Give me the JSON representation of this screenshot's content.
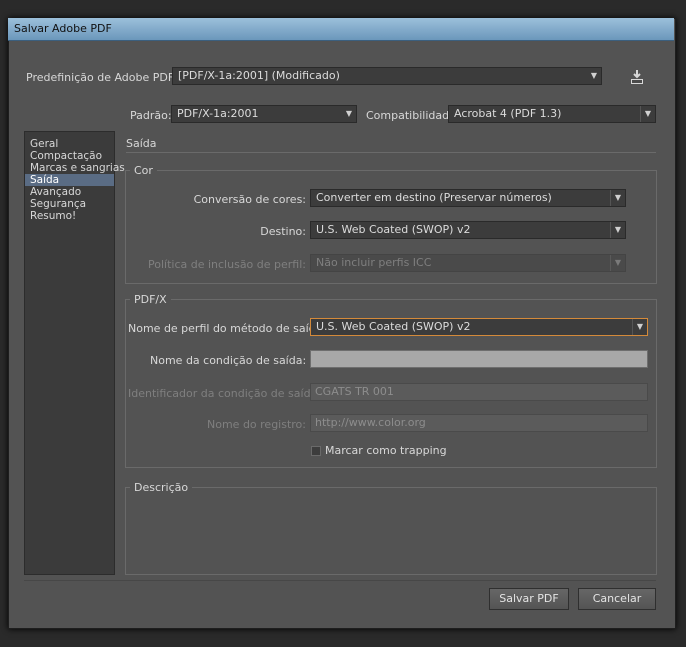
{
  "window": {
    "title": "Salvar Adobe PDF"
  },
  "preset": {
    "label": "Predefinição de Adobe PDF:",
    "value": "[PDF/X-1a:2001] (Modificado)",
    "save_icon": "save-preset-icon"
  },
  "standard": {
    "label": "Padrão:",
    "value": "PDF/X-1a:2001"
  },
  "compat": {
    "label": "Compatibilidade:",
    "value": "Acrobat 4 (PDF 1.3)"
  },
  "sidebar": {
    "items": [
      {
        "label": "Geral"
      },
      {
        "label": "Compactação"
      },
      {
        "label": "Marcas e sangrias"
      },
      {
        "label": "Saída"
      },
      {
        "label": "Avançado"
      },
      {
        "label": "Segurança"
      },
      {
        "label": "Resumo!"
      }
    ],
    "selected_index": 3
  },
  "section_title": "Saída",
  "color_group": {
    "title": "Cor",
    "conversion": {
      "label": "Conversão de cores:",
      "value": "Converter em destino (Preservar números)"
    },
    "destination": {
      "label": "Destino:",
      "value": "U.S. Web Coated (SWOP) v2"
    },
    "profile_policy": {
      "label": "Política de inclusão de perfil:",
      "value": "Não incluir perfis ICC"
    }
  },
  "pdfx_group": {
    "title": "PDF/X",
    "output_profile": {
      "label": "Nome de perfil do método de saída:",
      "value": "U.S. Web Coated (SWOP) v2"
    },
    "output_condition_name": {
      "label": "Nome da condição de saída:",
      "value": ""
    },
    "output_condition_id": {
      "label": "Identificador da condição de saída:",
      "value": "CGATS TR 001"
    },
    "registry_name": {
      "label": "Nome do registro:",
      "value": "http://www.color.org"
    },
    "trapped": {
      "label": "Marcar como trapping",
      "checked": false
    }
  },
  "description_group": {
    "title": "Descrição",
    "text": ""
  },
  "buttons": {
    "save": "Salvar PDF",
    "cancel": "Cancelar"
  }
}
